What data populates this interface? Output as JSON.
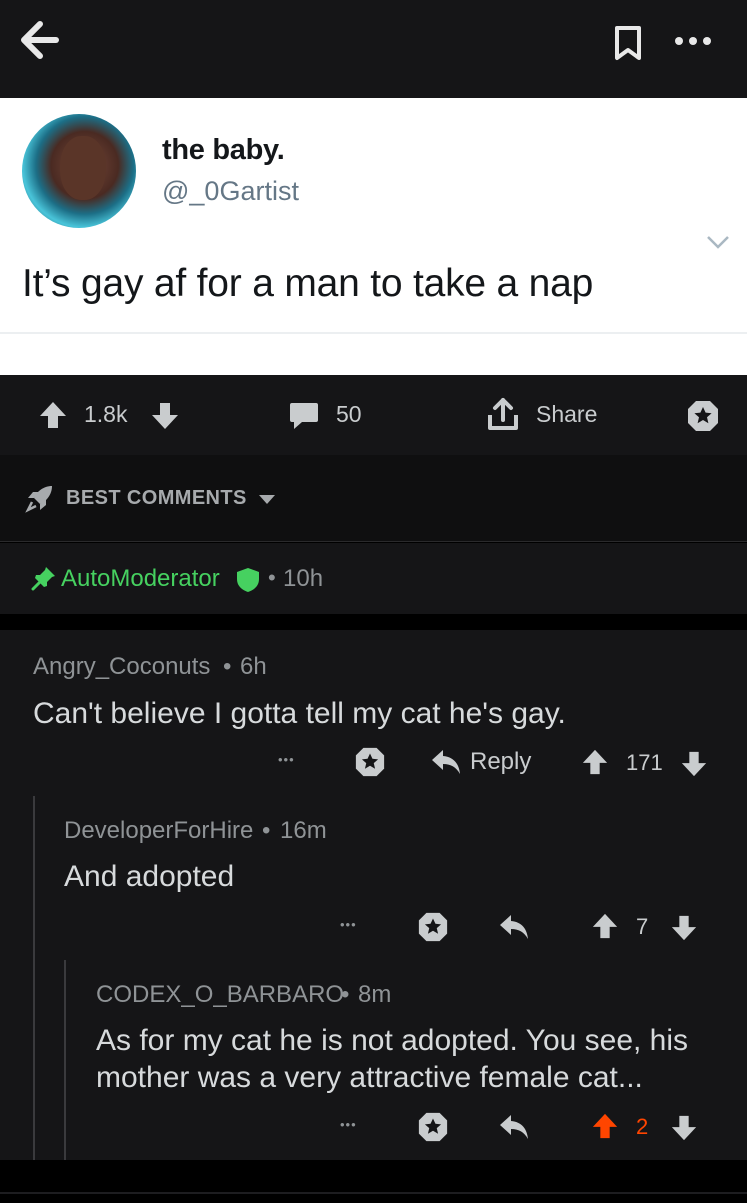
{
  "icons": {
    "back": "arrow-left-icon",
    "bookmark": "bookmark-icon",
    "more": "more-horizontal-icon",
    "chevron": "chevron-down-icon",
    "upvote": "arrow-up-icon",
    "downvote": "arrow-down-icon",
    "comment": "comment-bubble-icon",
    "share": "share-icon",
    "award": "award-star-icon",
    "rocket": "rocket-icon",
    "pin": "pin-icon",
    "shield": "shield-icon",
    "reply": "reply-arrow-icon"
  },
  "colors": {
    "background": "#151517",
    "mod_green": "#46d160",
    "upvote_orange": "#ff4500",
    "text_primary": "#d7dadc",
    "text_meta": "#8f9396"
  },
  "tweet": {
    "display_name": "the baby.",
    "handle": "@_0Gartist",
    "text": "It’s gay af for a man to take a nap"
  },
  "post_actions": {
    "score": "1.8k",
    "comments": "50",
    "share_label": "Share"
  },
  "sort": {
    "label": "BEST COMMENTS"
  },
  "automod": {
    "author": "AutoModerator",
    "separator": "•",
    "age": "10h"
  },
  "comments": [
    {
      "author": "Angry_Coconuts",
      "separator": "•",
      "age": "6h",
      "body": "Can't believe I gotta tell my cat he's gay.",
      "reply_label": "Reply",
      "score": "171",
      "more": "•••"
    },
    {
      "author": "DeveloperForHire",
      "separator": "•",
      "age": "16m",
      "body": "And adopted",
      "score": "7",
      "more": "•••"
    },
    {
      "author": "CODEX_O_BARBARO",
      "separator": "•",
      "age": "8m",
      "body_line1": "As for my cat he is not adopted. You see, his",
      "body_line2": "mother was a very attractive female cat...",
      "score": "2",
      "upvoted": true,
      "more": "•••"
    }
  ]
}
